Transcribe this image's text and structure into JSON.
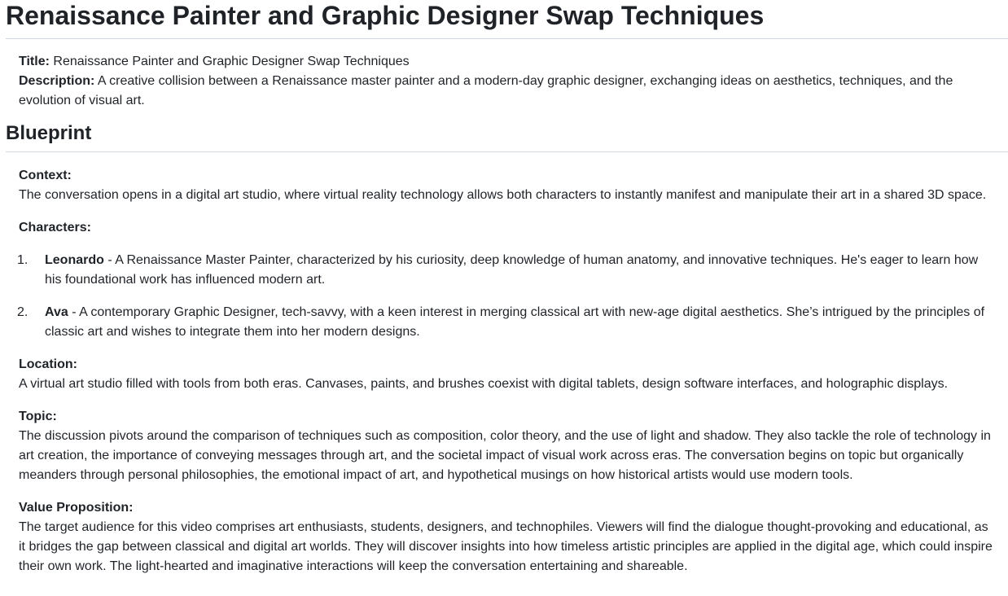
{
  "page_title": "Renaissance Painter and Graphic Designer Swap Techniques",
  "intro": {
    "title_label": "Title:",
    "title_value": " Renaissance Painter and Graphic Designer Swap Techniques",
    "description_label": "Description:",
    "description_value": " A creative collision between a Renaissance master painter and a modern-day graphic designer, exchanging ideas on aesthetics, techniques, and the evolution of visual art."
  },
  "blueprint": {
    "heading": "Blueprint",
    "context_label": "Context:",
    "context_text": "The conversation opens in a digital art studio, where virtual reality technology allows both characters to instantly manifest and manipulate their art in a shared 3D space.",
    "characters_label": "Characters:",
    "characters": [
      {
        "number": "1.",
        "name": "Leonardo",
        "description": " - A Renaissance Master Painter, characterized by his curiosity, deep knowledge of human anatomy, and innovative techniques. He's eager to learn how his foundational work has influenced modern art."
      },
      {
        "number": "2.",
        "name": "Ava",
        "description": " - A contemporary Graphic Designer, tech-savvy, with a keen interest in merging classical art with new-age digital aesthetics. She’s intrigued by the principles of classic art and wishes to integrate them into her modern designs."
      }
    ],
    "location_label": "Location:",
    "location_text": "A virtual art studio filled with tools from both eras. Canvases, paints, and brushes coexist with digital tablets, design software interfaces, and holographic displays.",
    "topic_label": "Topic:",
    "topic_text": "The discussion pivots around the comparison of techniques such as composition, color theory, and the use of light and shadow. They also tackle the role of technology in art creation, the importance of conveying messages through art, and the societal impact of visual work across eras. The conversation begins on topic but organically meanders through personal philosophies, the emotional impact of art, and hypothetical musings on how historical artists would use modern tools.",
    "value_label": "Value Proposition:",
    "value_text": "The target audience for this video comprises art enthusiasts, students, designers, and technophiles. Viewers will find the dialogue thought-provoking and educational, as it bridges the gap between classical and digital art worlds. They will discover insights into how timeless artistic principles are applied in the digital age, which could inspire their own work. The light-hearted and imaginative interactions will keep the conversation entertaining and shareable."
  }
}
